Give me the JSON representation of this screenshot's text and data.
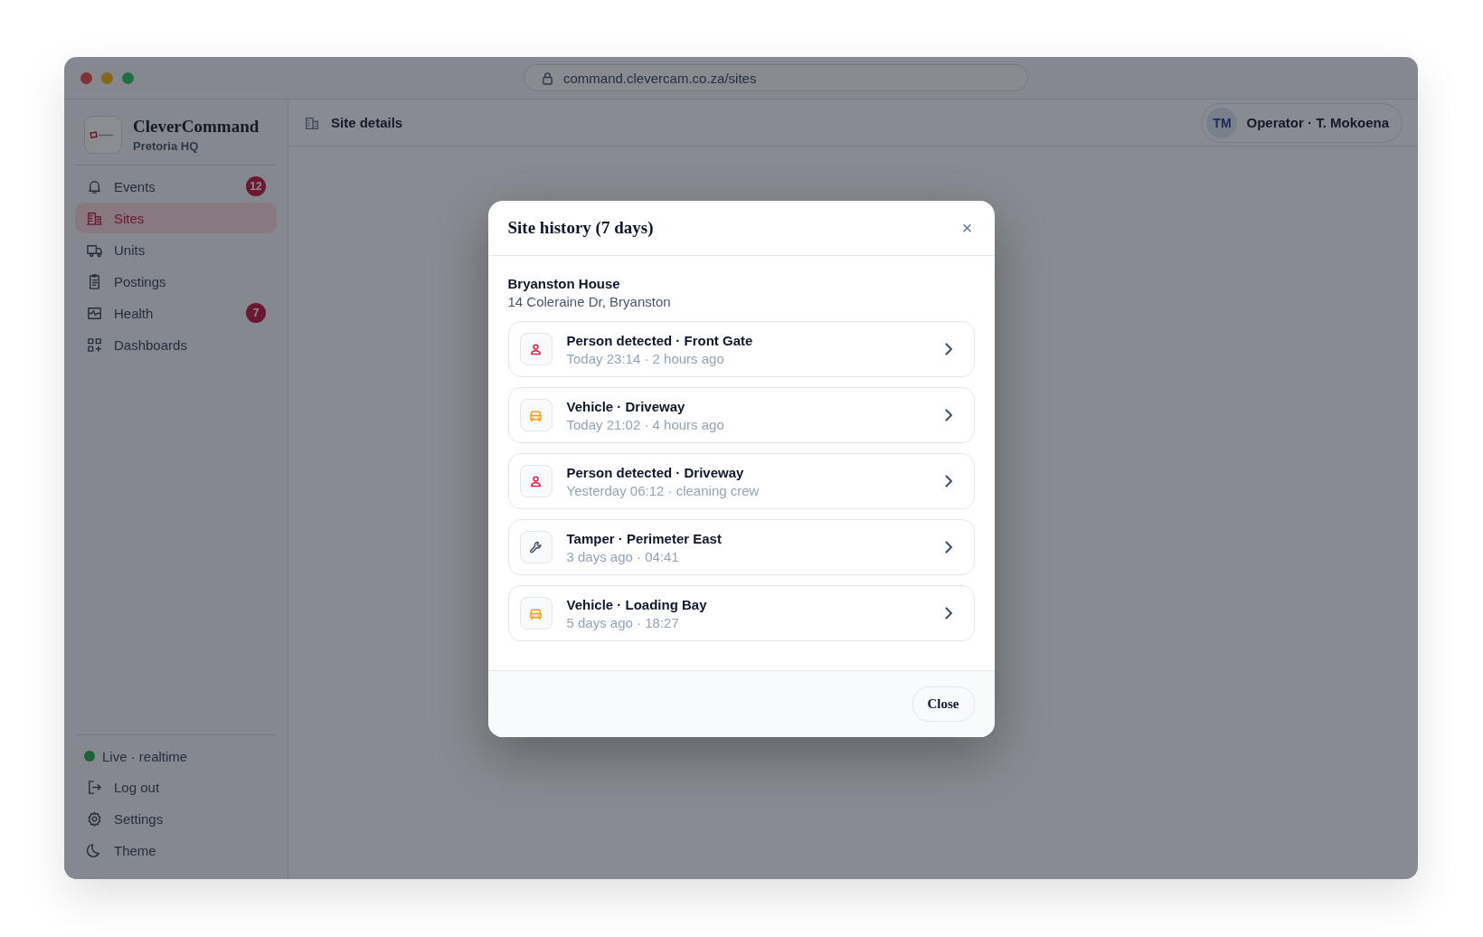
{
  "window": {
    "url": "command.clevercam.co.za/sites"
  },
  "sidebar": {
    "app_name": "CleverCommand",
    "location": "Pretoria HQ",
    "items": [
      {
        "label": "Events",
        "selected": false,
        "badge": "12"
      },
      {
        "label": "Sites",
        "selected": true
      },
      {
        "label": "Units",
        "selected": false
      },
      {
        "label": "Postings",
        "selected": false
      },
      {
        "label": "Health",
        "selected": false,
        "badge": "7"
      },
      {
        "label": "Dashboards",
        "selected": false
      }
    ],
    "status": {
      "label": "Live · realtime",
      "color": "#166534"
    },
    "footer_items": [
      {
        "label": "Log out"
      },
      {
        "label": "Settings"
      },
      {
        "label": "Theme"
      }
    ]
  },
  "header": {
    "title": "Site details",
    "user": {
      "initials": "TM",
      "label": "Operator · T. Mokoena"
    }
  },
  "modal": {
    "title": "Site history (7 days)",
    "close_icon": "×",
    "site_name": "Bryanston House",
    "site_address": "14 Coleraine Dr, Bryanston",
    "events": [
      {
        "kind": "person",
        "title": "Person detected · Front Gate",
        "detail": "Today 23:14 · 2 hours ago"
      },
      {
        "kind": "vehicle",
        "title": "Vehicle · Driveway",
        "detail": "Today 21:02 · 4 hours ago"
      },
      {
        "kind": "person",
        "title": "Person detected · Driveway",
        "detail": "Yesterday 06:12 · cleaning crew"
      },
      {
        "kind": "tamper",
        "title": "Tamper · Perimeter East",
        "detail": "3 days ago · 04:41"
      },
      {
        "kind": "vehicle",
        "title": "Vehicle · Loading Bay",
        "detail": "5 days ago · 18:27"
      }
    ],
    "close_button": "Close"
  }
}
